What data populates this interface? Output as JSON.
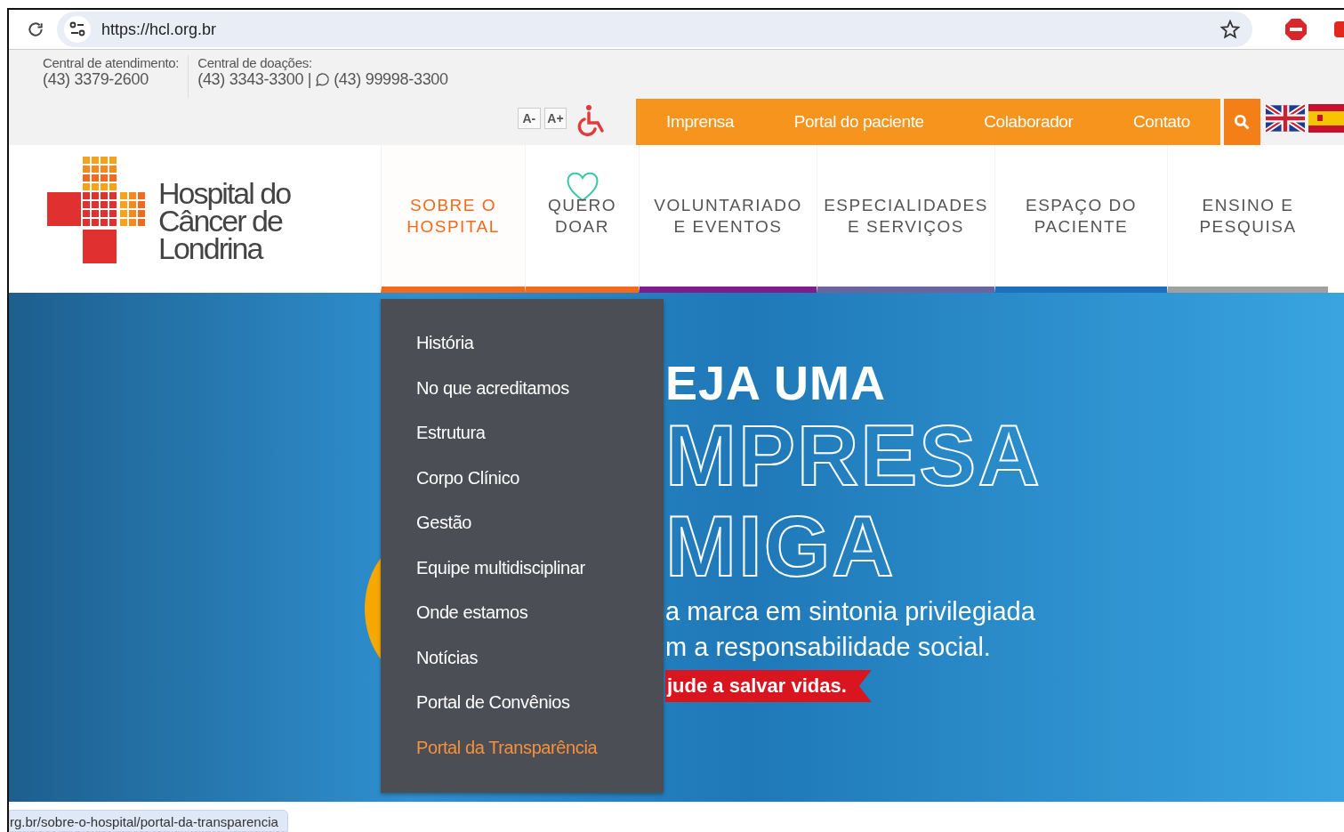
{
  "browser": {
    "url": "https://hcl.org.br"
  },
  "contacts": [
    {
      "label": "Central de atendimento:",
      "value": "(43) 3379-2600"
    },
    {
      "label": "Central de doações:",
      "value": "(43) 3343-3300 |",
      "whatsapp": "(43) 99998-3300"
    }
  ],
  "font_buttons": [
    "A-",
    "A+"
  ],
  "top_links": [
    "Imprensa",
    "Portal do paciente",
    "Colaborador",
    "Contato"
  ],
  "logo": {
    "lines": [
      "Hospital do",
      "Câncer de",
      "Londrina"
    ]
  },
  "nav": [
    {
      "label": "SOBRE O HOSPITAL",
      "selected": true,
      "color": "#f26a1b"
    },
    {
      "label": "QUERO DOAR",
      "selected": false,
      "color": "#f26a1b"
    },
    {
      "label": "VOLUNTARIADO E EVENTOS",
      "selected": false,
      "color": "#7b1e8c"
    },
    {
      "label": "ESPECIALIDADES E SERVIÇOS",
      "selected": false,
      "color": "#6a64a0"
    },
    {
      "label": "ESPAÇO DO PACIENTE",
      "selected": false,
      "color": "#1f6fbf"
    },
    {
      "label": "ENSINO E PESQUISA",
      "selected": false,
      "color": "#a0a0a0"
    }
  ],
  "dropdown": [
    {
      "label": "História",
      "selected": false
    },
    {
      "label": "No que acreditamos",
      "selected": false
    },
    {
      "label": "Estrutura",
      "selected": false
    },
    {
      "label": "Corpo Clínico",
      "selected": false
    },
    {
      "label": "Gestão",
      "selected": false
    },
    {
      "label": "Equipe multidisciplinar",
      "selected": false
    },
    {
      "label": "Onde estamos",
      "selected": false
    },
    {
      "label": "Notícias",
      "selected": false
    },
    {
      "label": "Portal de Convênios",
      "selected": false
    },
    {
      "label": "Portal da Transparência",
      "selected": true
    }
  ],
  "banner": {
    "heading": "EJA UMA",
    "outline": [
      "MPRESA",
      "MIGA"
    ],
    "lines": [
      "a marca em sintonia privilegiada",
      "m a responsabilidade social."
    ],
    "ribbon": "jude a salvar vidas."
  },
  "status_url": "rg.br/sobre-o-hospital/portal-da-transparencia"
}
